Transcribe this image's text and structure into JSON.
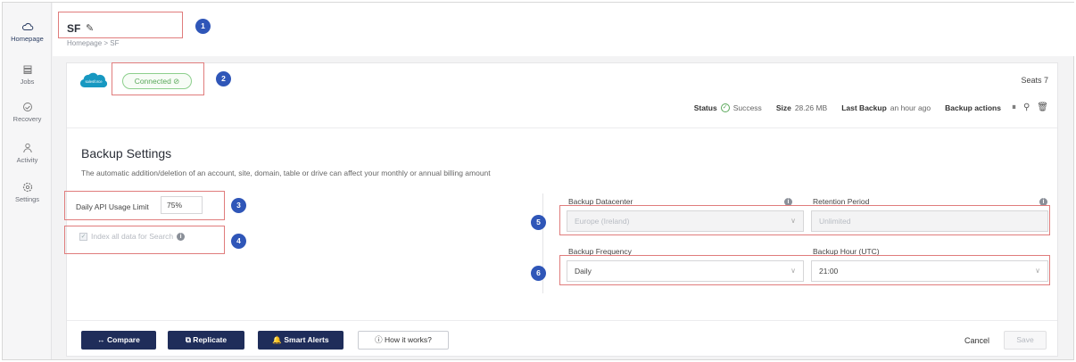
{
  "sidebar": {
    "items": [
      {
        "label": "Homepage",
        "icon": "cloud-icon"
      },
      {
        "label": "Jobs",
        "icon": "jobs-icon"
      },
      {
        "label": "Recovery",
        "icon": "recovery-icon"
      },
      {
        "label": "Activity",
        "icon": "activity-icon"
      },
      {
        "label": "Settings",
        "icon": "settings-icon"
      }
    ]
  },
  "header": {
    "title": "SF",
    "breadcrumb": "Homepage > SF"
  },
  "callouts": [
    "1",
    "2",
    "3",
    "4",
    "5",
    "6"
  ],
  "connection": {
    "status_label": "Connected ⊘"
  },
  "summary": {
    "seats": "Seats 7",
    "status_label": "Status",
    "status_value": "Success",
    "size_label": "Size",
    "size_value": "28.26 MB",
    "last_backup_label": "Last Backup",
    "last_backup_value": "an hour ago",
    "backup_actions_label": "Backup actions"
  },
  "settings": {
    "title": "Backup Settings",
    "description": "The automatic addition/deletion of an account, site, domain, table or drive can affect your monthly or annual billing amount",
    "api_limit_label": "Daily API Usage Limit",
    "api_limit_value": "75%",
    "index_label": "Index all data for Search",
    "datacenter_label": "Backup Datacenter",
    "datacenter_value": "Europe (Ireland)",
    "retention_label": "Retention Period",
    "retention_value": "Unlimited",
    "frequency_label": "Backup Frequency",
    "frequency_value": "Daily",
    "hour_label": "Backup Hour (UTC)",
    "hour_value": "21:00"
  },
  "footer": {
    "compare": "↔ Compare",
    "replicate": "⧉ Replicate",
    "smart_alerts": "🔔 Smart Alerts",
    "how_it_works": "ⓘ How it works?",
    "cancel": "Cancel",
    "save": "Save"
  },
  "colors": {
    "accent_dark": "#1f2d5a",
    "callout_blue": "#2f56b8",
    "highlight_red": "#e07c7c",
    "success_green": "#5aa85a",
    "salesforce_blue": "#1798c1"
  }
}
